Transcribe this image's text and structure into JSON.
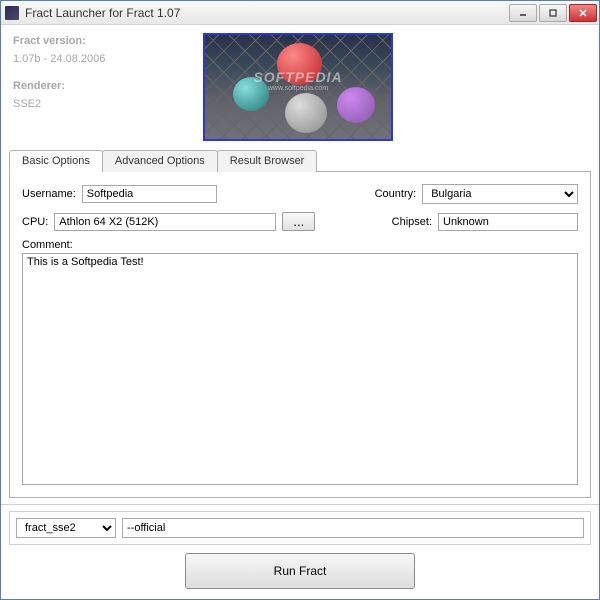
{
  "window": {
    "title": "Fract Launcher for Fract 1.07"
  },
  "info": {
    "version_label": "Fract version:",
    "version_value": "1.07b - 24.08.2006",
    "renderer_label": "Renderer:",
    "renderer_value": "SSE2"
  },
  "watermark": {
    "text": "SOFTPEDIA",
    "sub": "www.softpedia.com"
  },
  "tabs": {
    "basic": "Basic Options",
    "advanced": "Advanced Options",
    "results": "Result Browser"
  },
  "form": {
    "username_label": "Username:",
    "username_value": "Softpedia",
    "country_label": "Country:",
    "country_value": "Bulgaria",
    "cpu_label": "CPU:",
    "cpu_value": "Athlon 64 X2 (512K)",
    "cpu_browse": "...",
    "chipset_label": "Chipset:",
    "chipset_value": "Unknown",
    "comment_label": "Comment:",
    "comment_value": "This is a Softpedia Test!"
  },
  "footer": {
    "exe_value": "fract_sse2",
    "args_value": "--official",
    "run_label": "Run Fract"
  }
}
